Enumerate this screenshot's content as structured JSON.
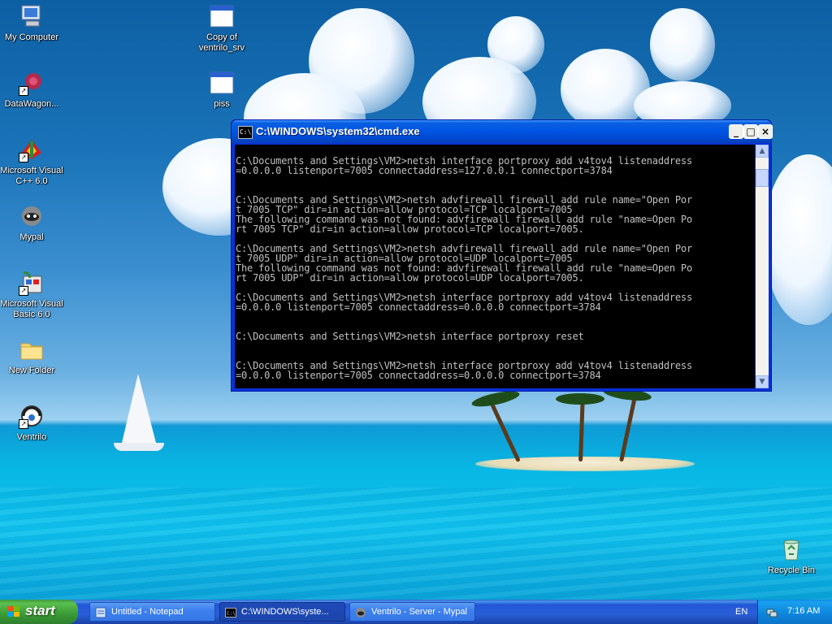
{
  "desktop": {
    "icons": [
      {
        "label": "My Computer",
        "icon": "computer-icon"
      },
      {
        "label": "DataWagon...",
        "icon": "datawagon-icon"
      },
      {
        "label": "Microsoft Visual C++ 6.0",
        "icon": "visual-cpp-icon"
      },
      {
        "label": "Mypal",
        "icon": "mypal-icon"
      },
      {
        "label": "Microsoft Visual Basic 6.0",
        "icon": "visual-basic-icon"
      },
      {
        "label": "New Folder",
        "icon": "folder-icon"
      },
      {
        "label": "Ventrilo",
        "icon": "ventrilo-icon"
      },
      {
        "label": "Copy of ventrilo_srv",
        "icon": "window-app-icon"
      },
      {
        "label": "piss",
        "icon": "window-app-icon"
      },
      {
        "label": "Recycle Bin",
        "icon": "recycle-bin-icon"
      }
    ]
  },
  "cmd_window": {
    "title": "C:\\WINDOWS\\system32\\cmd.exe",
    "icon_text": "C:\\",
    "minimize_label": "_",
    "maximize_label": "□",
    "close_label": "×",
    "output": "\nC:\\Documents and Settings\\VM2>netsh interface portproxy add v4tov4 listenaddress\n=0.0.0.0 listenport=7005 connectaddress=127.0.0.1 connectport=3784\n\n\nC:\\Documents and Settings\\VM2>netsh advfirewall firewall add rule name=\"Open Por\nt 7005 TCP\" dir=in action=allow protocol=TCP localport=7005\nThe following command was not found: advfirewall firewall add rule \"name=Open Po\nrt 7005 TCP\" dir=in action=allow protocol=TCP localport=7005.\n\nC:\\Documents and Settings\\VM2>netsh advfirewall firewall add rule name=\"Open Por\nt 7005 UDP\" dir=in action=allow protocol=UDP localport=7005\nThe following command was not found: advfirewall firewall add rule \"name=Open Po\nrt 7005 UDP\" dir=in action=allow protocol=UDP localport=7005.\n\nC:\\Documents and Settings\\VM2>netsh interface portproxy add v4tov4 listenaddress\n=0.0.0.0 listenport=7005 connectaddress=0.0.0.0 connectport=3784\n\n\nC:\\Documents and Settings\\VM2>netsh interface portproxy reset\n\n\nC:\\Documents and Settings\\VM2>netsh interface portproxy add v4tov4 listenaddress\n=0.0.0.0 listenport=7005 connectaddress=0.0.0.0 connectport=3784",
    "scroll_up": "▲",
    "scroll_down": "▼"
  },
  "taskbar": {
    "start_label": "start",
    "tasks": [
      {
        "label": "Untitled - Notepad",
        "icon": "notepad-icon",
        "active": false
      },
      {
        "label": "C:\\WINDOWS\\syste...",
        "icon": "cmd-icon",
        "active": true
      },
      {
        "label": "Ventrilo - Server - Mypal",
        "icon": "mypal-icon",
        "active": false
      }
    ],
    "language": "EN",
    "clock": "7:16 AM"
  },
  "colors": {
    "titlebar": "#0054e3",
    "console_bg": "#000000",
    "console_fg": "#c0c0c0",
    "start_green": "#3a9a36",
    "taskbar_blue": "#245edb"
  }
}
